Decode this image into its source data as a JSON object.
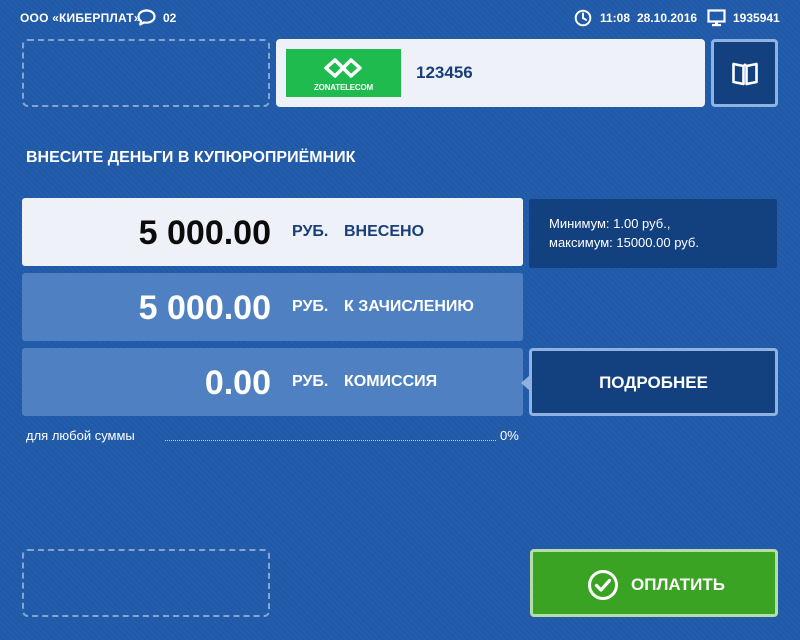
{
  "header": {
    "company": "ООО «КИБЕРПЛАТ»",
    "messages_count": "02",
    "time": "11:08",
    "date": "28.10.2016",
    "terminal_id": "1935941",
    "icons": [
      "chat-icon",
      "clock-icon",
      "monitor-icon"
    ]
  },
  "provider": {
    "logo_text": "ZONATELECOM",
    "logo_color": "#1fbb4f",
    "account": "123456",
    "help_icon": "book-icon"
  },
  "instruction": "ВНЕСИТЕ ДЕНЬГИ В КУПЮРОПРИЁМНИК",
  "amounts": [
    {
      "value": "5 000.00",
      "currency": "РУБ.",
      "label": "ВНЕСЕНО"
    },
    {
      "value": "5 000.00",
      "currency": "РУБ.",
      "label": "К ЗАЧИСЛЕНИЮ"
    },
    {
      "value": "0.00",
      "currency": "РУБ.",
      "label": "КОМИССИЯ"
    }
  ],
  "limits": {
    "min": "Минимум: 1.00 руб.,",
    "max": "максимум: 15000.00 руб."
  },
  "details_button": "ПОДРОБНЕЕ",
  "commission": {
    "label": "для любой суммы",
    "rate": "0%"
  },
  "pay_button": {
    "label": "ОПЛАТИТЬ",
    "icon": "check-circle-icon",
    "color": "#3aa324"
  },
  "colors": {
    "background": "#1f59a8",
    "dark_panel": "#13407f",
    "light_row": "#eef2f8",
    "mid_row": "#4f80c2"
  }
}
